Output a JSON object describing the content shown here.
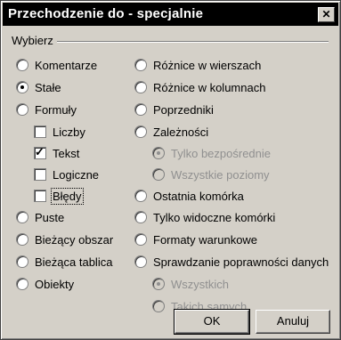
{
  "dialog": {
    "title": "Przechodzenie do - specjalnie",
    "close_glyph": "✕",
    "group_label": "Wybierz",
    "col1": [
      {
        "label": "Komentarze",
        "kind": "radio",
        "checked": false,
        "disabled": false
      },
      {
        "label": "Stałe",
        "kind": "radio",
        "checked": true,
        "disabled": false
      },
      {
        "label": "Formuły",
        "kind": "radio",
        "checked": false,
        "disabled": false
      },
      {
        "label": "Liczby",
        "kind": "checkbox",
        "checked": false,
        "disabled": false
      },
      {
        "label": "Tekst",
        "kind": "checkbox",
        "checked": true,
        "disabled": false
      },
      {
        "label": "Logiczne",
        "kind": "checkbox",
        "checked": false,
        "disabled": false
      },
      {
        "label": "Błędy",
        "kind": "checkbox",
        "checked": false,
        "disabled": false,
        "focused": true
      },
      {
        "label": "Puste",
        "kind": "radio",
        "checked": false,
        "disabled": false
      },
      {
        "label": "Bieżący obszar",
        "kind": "radio",
        "checked": false,
        "disabled": false
      },
      {
        "label": "Bieżąca tablica",
        "kind": "radio",
        "checked": false,
        "disabled": false
      },
      {
        "label": "Obiekty",
        "kind": "radio",
        "checked": false,
        "disabled": false
      }
    ],
    "col2": [
      {
        "label": "Różnice w wierszach",
        "kind": "radio",
        "checked": false,
        "disabled": false
      },
      {
        "label": "Różnice w kolumnach",
        "kind": "radio",
        "checked": false,
        "disabled": false
      },
      {
        "label": "Poprzedniki",
        "kind": "radio",
        "checked": false,
        "disabled": false
      },
      {
        "label": "Zależności",
        "kind": "radio",
        "checked": false,
        "disabled": false
      },
      {
        "label": "Tylko bezpośrednie",
        "kind": "radio",
        "checked": true,
        "disabled": true
      },
      {
        "label": "Wszystkie poziomy",
        "kind": "radio",
        "checked": false,
        "disabled": true
      },
      {
        "label": "Ostatnia komórka",
        "kind": "radio",
        "checked": false,
        "disabled": false
      },
      {
        "label": "Tylko widoczne komórki",
        "kind": "radio",
        "checked": false,
        "disabled": false
      },
      {
        "label": "Formaty warunkowe",
        "kind": "radio",
        "checked": false,
        "disabled": false
      },
      {
        "label": "Sprawdzanie poprawności danych",
        "kind": "radio",
        "checked": false,
        "disabled": false
      },
      {
        "label": "Wszystkich",
        "kind": "radio",
        "checked": true,
        "disabled": true
      },
      {
        "label": "Takich samych",
        "kind": "radio",
        "checked": false,
        "disabled": true
      }
    ],
    "ok_label": "OK",
    "cancel_label": "Anuluj"
  }
}
